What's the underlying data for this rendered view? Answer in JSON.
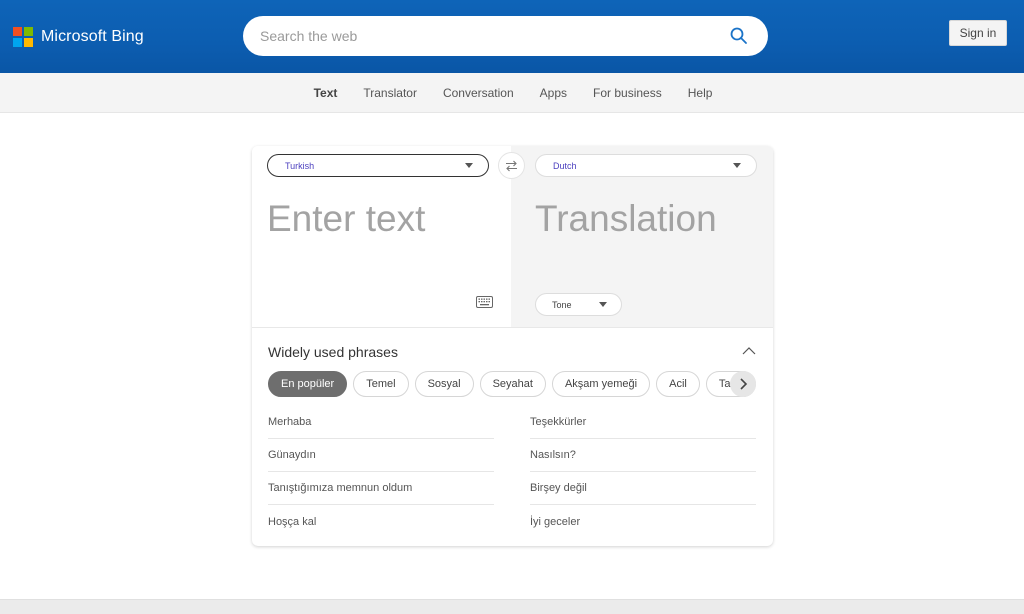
{
  "header": {
    "brand": "Microsoft Bing",
    "logo_colors": [
      "#f25022",
      "#7fba00",
      "#00a4ef",
      "#ffb900"
    ],
    "search_placeholder": "Search the web",
    "search_value": "",
    "search_icon": "search-icon",
    "sign_in_label": "Sign in"
  },
  "nav": {
    "items": [
      {
        "label": "Text",
        "active": true
      },
      {
        "label": "Translator",
        "active": false
      },
      {
        "label": "Conversation",
        "active": false
      },
      {
        "label": "Apps",
        "active": false
      },
      {
        "label": "For business",
        "active": false
      },
      {
        "label": "Help",
        "active": false
      }
    ]
  },
  "translator": {
    "source_language": "Turkish",
    "target_language": "Dutch",
    "swap_icon": "swap-arrows-icon",
    "source_placeholder": "Enter text",
    "source_value": "",
    "target_placeholder": "Translation",
    "keyboard_icon": "keyboard-icon",
    "tone_label": "Tone"
  },
  "phrases": {
    "title": "Widely used phrases",
    "categories": [
      {
        "label": "En popüler",
        "active": true
      },
      {
        "label": "Temel",
        "active": false
      },
      {
        "label": "Sosyal",
        "active": false
      },
      {
        "label": "Seyahat",
        "active": false
      },
      {
        "label": "Akşam yemeği",
        "active": false
      },
      {
        "label": "Acil",
        "active": false
      },
      {
        "label": "Tarih",
        "active": false
      }
    ],
    "left_column": [
      "Merhaba",
      "Günaydın",
      "Tanıştığımıza memnun oldum",
      "Hoşça kal"
    ],
    "right_column": [
      "Teşekkürler",
      "Nasılsın?",
      "Birşey değil",
      "İyi geceler"
    ]
  }
}
